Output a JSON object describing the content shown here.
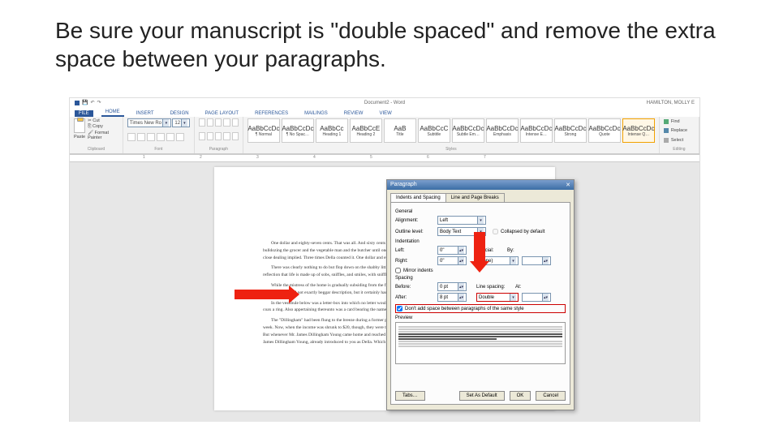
{
  "slide": {
    "title": "Be sure your manuscript is \"double spaced\" and remove the extra space between your paragraphs."
  },
  "titlebar": {
    "doc": "Document2 - Word",
    "user": "HAMILTON, MOLLY E"
  },
  "tabs": [
    "FILE",
    "HOME",
    "INSERT",
    "DESIGN",
    "PAGE LAYOUT",
    "REFERENCES",
    "MAILINGS",
    "REVIEW",
    "VIEW"
  ],
  "ribbon": {
    "clipboard": {
      "paste": "Paste",
      "cut": "Cut",
      "copy": "Copy",
      "painter": "Format Painter",
      "label": "Clipboard"
    },
    "font": {
      "name": "Times New Ro",
      "size": "12",
      "label": "Font"
    },
    "paragraph": {
      "label": "Paragraph"
    },
    "styles": {
      "label": "Styles",
      "items": [
        {
          "sample": "AaBbCcDc",
          "name": "¶ Normal"
        },
        {
          "sample": "AaBbCcDc",
          "name": "¶ No Spac…"
        },
        {
          "sample": "AaBbCc",
          "name": "Heading 1"
        },
        {
          "sample": "AaBbCcE",
          "name": "Heading 2"
        },
        {
          "sample": "AaB",
          "name": "Title"
        },
        {
          "sample": "AaBbCcC",
          "name": "Subtitle"
        },
        {
          "sample": "AaBbCcDc",
          "name": "Subtle Em…"
        },
        {
          "sample": "AaBbCcDc",
          "name": "Emphasis"
        },
        {
          "sample": "AaBbCcDc",
          "name": "Intense E…"
        },
        {
          "sample": "AaBbCcDc",
          "name": "Strong"
        },
        {
          "sample": "AaBbCcDc",
          "name": "Quote"
        },
        {
          "sample": "AaBbCcDc",
          "name": "Intense Q…"
        }
      ]
    },
    "editing": {
      "find": "Find",
      "replace": "Replace",
      "select": "Select",
      "label": "Editing"
    }
  },
  "ruler": {
    "marks": [
      "1",
      "2",
      "3",
      "4",
      "5",
      "6",
      "7"
    ]
  },
  "page": {
    "paras": [
      "One dollar and eighty-seven cents. That was all. And sixty cents of it was in pennies. Pennies saved one and two at a time by bulldozing the grocer and the vegetable man and the butcher until one's cheeks burned with the silent imputation of parsimony that such close dealing implied. Three times Della counted it. One dollar and eighty-seven cents. And the next day would be Christmas.",
      "There was clearly nothing to do but flop down on the shabby little couch and howl. So Della did it. Which instigates the moral reflection that life is made up of sobs, sniffles, and smiles, with sniffles predominating.",
      "While the mistress of the home is gradually subsiding from the first stage to the second, take a look at the home. A furnished flat at $8 per week. It did not exactly beggar description, but it certainly had that word on the lookout for the mendicancy squad.",
      "In the vestibule below was a letter-box into which no letter would go, and an electric button from which no mortal finger could coax a ring. Also appertaining thereunto was a card bearing the name \"Mr. James Dillingham Young.\"",
      "The \"Dillingham\" had been flung to the breeze during a former period of prosperity when its possessor was being paid $30 per week. Now, when the income was shrunk to $20, though, they were thinking seriously of contracting to a modest and unassuming D. But whenever Mr. James Dillingham Young came home and reached his flat above he was called \"Jim\" and greatly hugged by Mrs. James Dillingham Young, already introduced to you as Della. Which is all very good."
    ]
  },
  "dialog": {
    "title": "Paragraph",
    "tabs": [
      "Indents and Spacing",
      "Line and Page Breaks"
    ],
    "general": {
      "label": "General",
      "alignment_lbl": "Alignment:",
      "alignment": "Left",
      "outline_lbl": "Outline level:",
      "outline": "Body Text",
      "collapsed": "Collapsed by default"
    },
    "indent": {
      "label": "Indentation",
      "left_lbl": "Left:",
      "left": "0\"",
      "right_lbl": "Right:",
      "right": "0\"",
      "special_lbl": "Special:",
      "special": "(none)",
      "by_lbl": "By:",
      "mirror": "Mirror indents"
    },
    "spacing": {
      "label": "Spacing",
      "before_lbl": "Before:",
      "before": "0 pt",
      "after_lbl": "After:",
      "after": "8 pt",
      "line_lbl": "Line spacing:",
      "line": "Double",
      "at_lbl": "At:",
      "nospace": "Don't add space between paragraphs of the same style"
    },
    "preview_lbl": "Preview",
    "buttons": {
      "tabs": "Tabs…",
      "default": "Set As Default",
      "ok": "OK",
      "cancel": "Cancel"
    }
  }
}
